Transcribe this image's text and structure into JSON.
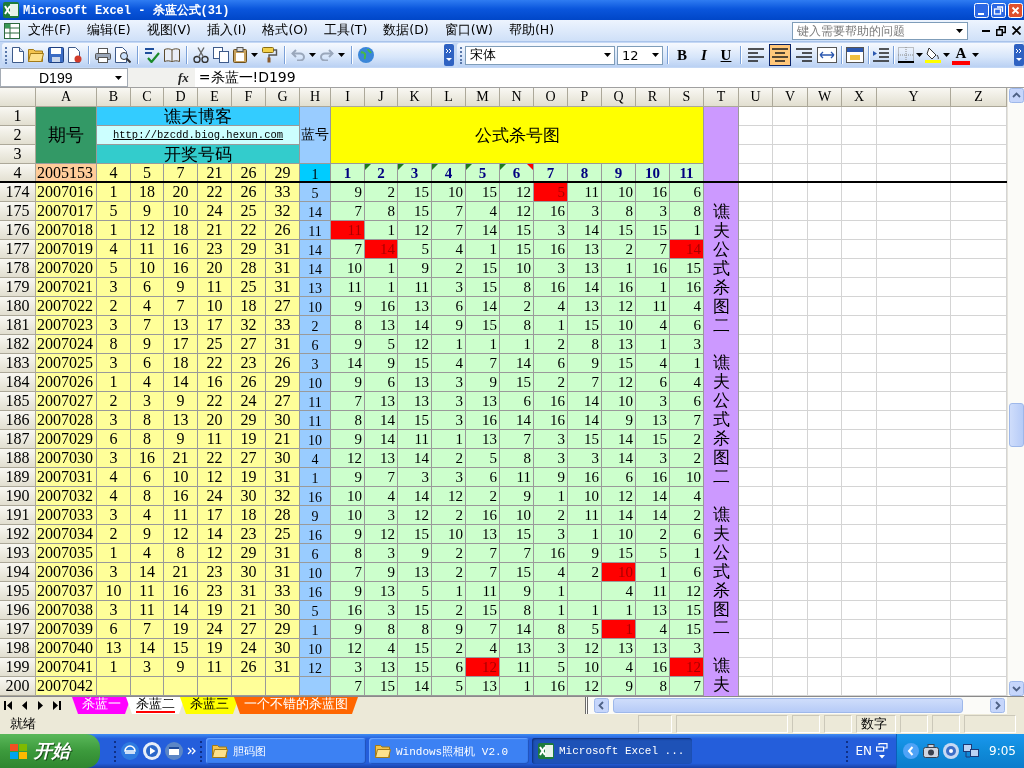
{
  "window": {
    "title": "Microsoft Excel - 杀蓝公式(31)"
  },
  "menu": [
    "文件(F)",
    "编辑(E)",
    "视图(V)",
    "插入(I)",
    "格式(O)",
    "工具(T)",
    "数据(D)",
    "窗口(W)",
    "帮助(H)"
  ],
  "help_box": {
    "placeholder": "键入需要帮助的问题"
  },
  "toolbar": {
    "undo": {
      "disabled": true
    },
    "redo": {
      "disabled": true
    },
    "font": "宋体",
    "font_size": "12",
    "bold": "B",
    "italic": "I",
    "underline": "U",
    "alignment": [
      {
        "kind": "left",
        "selected": false
      },
      {
        "kind": "center",
        "selected": true
      },
      {
        "kind": "right",
        "selected": false
      }
    ],
    "font_color": "A"
  },
  "formula_bar": {
    "name_box": "D199",
    "function_button": "fx",
    "formula": "=杀蓝一!D199"
  },
  "columns": [
    "A",
    "B",
    "C",
    "D",
    "E",
    "F",
    "G",
    "H",
    "I",
    "J",
    "K",
    "L",
    "M",
    "N",
    "O",
    "P",
    "Q",
    "R",
    "S",
    "T",
    "U",
    "V",
    "W",
    "X",
    "Y",
    "Z"
  ],
  "header_block": {
    "row_numbers": [
      "1",
      "2",
      "3"
    ],
    "issue_heading": "期号",
    "blog_title": "谯夫博客",
    "blog_link": "http://bzcdd.biog.hexun.com",
    "draw_heading": "开奖号码",
    "blue_heading": "蓝号",
    "chart_heading": "公式杀号图"
  },
  "row_4": {
    "row_number": "4",
    "issue": "2005153",
    "draw": [
      "4",
      "5",
      "7",
      "21",
      "26",
      "29"
    ],
    "blue": "1",
    "formula_numbers": [
      {
        "label": "1",
        "error_indicator": false,
        "comment_indicator": false
      },
      {
        "label": "2",
        "error_indicator": true,
        "comment_indicator": false
      },
      {
        "label": "3",
        "error_indicator": true,
        "comment_indicator": false
      },
      {
        "label": "4",
        "error_indicator": true,
        "comment_indicator": false
      },
      {
        "label": "5",
        "error_indicator": true,
        "comment_indicator": false
      },
      {
        "label": "6",
        "error_indicator": true,
        "comment_indicator": true
      },
      {
        "label": "7",
        "error_indicator": false,
        "comment_indicator": false
      },
      {
        "label": "8",
        "error_indicator": false,
        "comment_indicator": false
      },
      {
        "label": "9",
        "error_indicator": false,
        "comment_indicator": false
      },
      {
        "label": "10",
        "error_indicator": false,
        "comment_indicator": false
      },
      {
        "label": "11",
        "error_indicator": false,
        "comment_indicator": false
      }
    ]
  },
  "rows": [
    {
      "row_number": "174",
      "issue": "2007016",
      "draw": [
        "1",
        "18",
        "20",
        "22",
        "26",
        "33"
      ],
      "blue": "5",
      "kills": [
        {
          "value": "9",
          "highlighted": false
        },
        {
          "value": "2",
          "highlighted": false
        },
        {
          "value": "15",
          "highlighted": false
        },
        {
          "value": "10",
          "highlighted": false
        },
        {
          "value": "15",
          "highlighted": false
        },
        {
          "value": "12",
          "highlighted": false
        },
        {
          "value": "5",
          "highlighted": true
        },
        {
          "value": "11",
          "highlighted": false
        },
        {
          "value": "10",
          "highlighted": false
        },
        {
          "value": "16",
          "highlighted": false
        },
        {
          "value": "6",
          "highlighted": false
        }
      ]
    },
    {
      "row_number": "175",
      "issue": "2007017",
      "draw": [
        "5",
        "9",
        "10",
        "24",
        "25",
        "32"
      ],
      "blue": "14",
      "kills": [
        {
          "value": "7",
          "highlighted": false
        },
        {
          "value": "8",
          "highlighted": false
        },
        {
          "value": "15",
          "highlighted": false
        },
        {
          "value": "7",
          "highlighted": false
        },
        {
          "value": "4",
          "highlighted": false
        },
        {
          "value": "12",
          "highlighted": false
        },
        {
          "value": "16",
          "highlighted": false
        },
        {
          "value": "3",
          "highlighted": false
        },
        {
          "value": "8",
          "highlighted": false
        },
        {
          "value": "3",
          "highlighted": false
        },
        {
          "value": "8",
          "highlighted": false
        }
      ]
    },
    {
      "row_number": "176",
      "issue": "2007018",
      "draw": [
        "1",
        "12",
        "18",
        "21",
        "22",
        "26"
      ],
      "blue": "11",
      "kills": [
        {
          "value": "11",
          "highlighted": true
        },
        {
          "value": "1",
          "highlighted": false
        },
        {
          "value": "12",
          "highlighted": false
        },
        {
          "value": "7",
          "highlighted": false
        },
        {
          "value": "14",
          "highlighted": false
        },
        {
          "value": "15",
          "highlighted": false
        },
        {
          "value": "3",
          "highlighted": false
        },
        {
          "value": "14",
          "highlighted": false
        },
        {
          "value": "15",
          "highlighted": false
        },
        {
          "value": "15",
          "highlighted": false
        },
        {
          "value": "1",
          "highlighted": false
        }
      ]
    },
    {
      "row_number": "177",
      "issue": "2007019",
      "draw": [
        "4",
        "11",
        "16",
        "23",
        "29",
        "31"
      ],
      "blue": "14",
      "kills": [
        {
          "value": "7",
          "highlighted": false
        },
        {
          "value": "14",
          "highlighted": true
        },
        {
          "value": "5",
          "highlighted": false
        },
        {
          "value": "4",
          "highlighted": false
        },
        {
          "value": "1",
          "highlighted": false
        },
        {
          "value": "15",
          "highlighted": false
        },
        {
          "value": "16",
          "highlighted": false
        },
        {
          "value": "13",
          "highlighted": false
        },
        {
          "value": "2",
          "highlighted": false
        },
        {
          "value": "7",
          "highlighted": false
        },
        {
          "value": "14",
          "highlighted": true
        }
      ]
    },
    {
      "row_number": "178",
      "issue": "2007020",
      "draw": [
        "5",
        "10",
        "16",
        "20",
        "28",
        "31"
      ],
      "blue": "14",
      "kills": [
        {
          "value": "10",
          "highlighted": false
        },
        {
          "value": "1",
          "highlighted": false
        },
        {
          "value": "9",
          "highlighted": false
        },
        {
          "value": "2",
          "highlighted": false
        },
        {
          "value": "15",
          "highlighted": false
        },
        {
          "value": "10",
          "highlighted": false
        },
        {
          "value": "3",
          "highlighted": false
        },
        {
          "value": "13",
          "highlighted": false
        },
        {
          "value": "1",
          "highlighted": false
        },
        {
          "value": "16",
          "highlighted": false
        },
        {
          "value": "15",
          "highlighted": false
        }
      ]
    },
    {
      "row_number": "179",
      "issue": "2007021",
      "draw": [
        "3",
        "6",
        "9",
        "11",
        "25",
        "31"
      ],
      "blue": "13",
      "kills": [
        {
          "value": "11",
          "highlighted": false
        },
        {
          "value": "1",
          "highlighted": false
        },
        {
          "value": "11",
          "highlighted": false
        },
        {
          "value": "3",
          "highlighted": false
        },
        {
          "value": "15",
          "highlighted": false
        },
        {
          "value": "8",
          "highlighted": false
        },
        {
          "value": "16",
          "highlighted": false
        },
        {
          "value": "14",
          "highlighted": false
        },
        {
          "value": "16",
          "highlighted": false
        },
        {
          "value": "1",
          "highlighted": false
        },
        {
          "value": "16",
          "highlighted": false
        }
      ]
    },
    {
      "row_number": "180",
      "issue": "2007022",
      "draw": [
        "2",
        "4",
        "7",
        "10",
        "18",
        "27"
      ],
      "blue": "10",
      "kills": [
        {
          "value": "9",
          "highlighted": false
        },
        {
          "value": "16",
          "highlighted": false
        },
        {
          "value": "13",
          "highlighted": false
        },
        {
          "value": "6",
          "highlighted": false
        },
        {
          "value": "14",
          "highlighted": false
        },
        {
          "value": "2",
          "highlighted": false
        },
        {
          "value": "4",
          "highlighted": false
        },
        {
          "value": "13",
          "highlighted": false
        },
        {
          "value": "12",
          "highlighted": false
        },
        {
          "value": "11",
          "highlighted": false
        },
        {
          "value": "4",
          "highlighted": false
        }
      ]
    },
    {
      "row_number": "181",
      "issue": "2007023",
      "draw": [
        "3",
        "7",
        "13",
        "17",
        "32",
        "33"
      ],
      "blue": "2",
      "kills": [
        {
          "value": "8",
          "highlighted": false
        },
        {
          "value": "13",
          "highlighted": false
        },
        {
          "value": "14",
          "highlighted": false
        },
        {
          "value": "9",
          "highlighted": false
        },
        {
          "value": "15",
          "highlighted": false
        },
        {
          "value": "8",
          "highlighted": false
        },
        {
          "value": "1",
          "highlighted": false
        },
        {
          "value": "15",
          "highlighted": false
        },
        {
          "value": "10",
          "highlighted": false
        },
        {
          "value": "4",
          "highlighted": false
        },
        {
          "value": "6",
          "highlighted": false
        }
      ]
    },
    {
      "row_number": "182",
      "issue": "2007024",
      "draw": [
        "8",
        "9",
        "17",
        "25",
        "27",
        "31"
      ],
      "blue": "6",
      "kills": [
        {
          "value": "9",
          "highlighted": false
        },
        {
          "value": "5",
          "highlighted": false
        },
        {
          "value": "12",
          "highlighted": false
        },
        {
          "value": "1",
          "highlighted": false
        },
        {
          "value": "1",
          "highlighted": false
        },
        {
          "value": "1",
          "highlighted": false
        },
        {
          "value": "2",
          "highlighted": false
        },
        {
          "value": "8",
          "highlighted": false
        },
        {
          "value": "13",
          "highlighted": false
        },
        {
          "value": "1",
          "highlighted": false
        },
        {
          "value": "3",
          "highlighted": false
        }
      ]
    },
    {
      "row_number": "183",
      "issue": "2007025",
      "draw": [
        "3",
        "6",
        "18",
        "22",
        "23",
        "26"
      ],
      "blue": "3",
      "kills": [
        {
          "value": "14",
          "highlighted": false
        },
        {
          "value": "9",
          "highlighted": false
        },
        {
          "value": "15",
          "highlighted": false
        },
        {
          "value": "4",
          "highlighted": false
        },
        {
          "value": "7",
          "highlighted": false
        },
        {
          "value": "14",
          "highlighted": false
        },
        {
          "value": "6",
          "highlighted": false
        },
        {
          "value": "9",
          "highlighted": false
        },
        {
          "value": "15",
          "highlighted": false
        },
        {
          "value": "4",
          "highlighted": false
        },
        {
          "value": "1",
          "highlighted": false
        }
      ]
    },
    {
      "row_number": "184",
      "issue": "2007026",
      "draw": [
        "1",
        "4",
        "14",
        "16",
        "26",
        "29"
      ],
      "blue": "10",
      "kills": [
        {
          "value": "9",
          "highlighted": false
        },
        {
          "value": "6",
          "highlighted": false
        },
        {
          "value": "13",
          "highlighted": false
        },
        {
          "value": "3",
          "highlighted": false
        },
        {
          "value": "9",
          "highlighted": false
        },
        {
          "value": "15",
          "highlighted": false
        },
        {
          "value": "2",
          "highlighted": false
        },
        {
          "value": "7",
          "highlighted": false
        },
        {
          "value": "12",
          "highlighted": false
        },
        {
          "value": "6",
          "highlighted": false
        },
        {
          "value": "4",
          "highlighted": false
        }
      ]
    },
    {
      "row_number": "185",
      "issue": "2007027",
      "draw": [
        "2",
        "3",
        "9",
        "22",
        "24",
        "27"
      ],
      "blue": "11",
      "kills": [
        {
          "value": "7",
          "highlighted": false
        },
        {
          "value": "13",
          "highlighted": false
        },
        {
          "value": "13",
          "highlighted": false
        },
        {
          "value": "3",
          "highlighted": false
        },
        {
          "value": "13",
          "highlighted": false
        },
        {
          "value": "6",
          "highlighted": false
        },
        {
          "value": "16",
          "highlighted": false
        },
        {
          "value": "14",
          "highlighted": false
        },
        {
          "value": "10",
          "highlighted": false
        },
        {
          "value": "3",
          "highlighted": false
        },
        {
          "value": "6",
          "highlighted": false
        }
      ]
    },
    {
      "row_number": "186",
      "issue": "2007028",
      "draw": [
        "3",
        "8",
        "13",
        "20",
        "29",
        "30"
      ],
      "blue": "11",
      "kills": [
        {
          "value": "8",
          "highlighted": false
        },
        {
          "value": "14",
          "highlighted": false
        },
        {
          "value": "15",
          "highlighted": false
        },
        {
          "value": "3",
          "highlighted": false
        },
        {
          "value": "16",
          "highlighted": false
        },
        {
          "value": "14",
          "highlighted": false
        },
        {
          "value": "16",
          "highlighted": false
        },
        {
          "value": "14",
          "highlighted": false
        },
        {
          "value": "9",
          "highlighted": false
        },
        {
          "value": "13",
          "highlighted": false
        },
        {
          "value": "7",
          "highlighted": false
        }
      ]
    },
    {
      "row_number": "187",
      "issue": "2007029",
      "draw": [
        "6",
        "8",
        "9",
        "11",
        "19",
        "21"
      ],
      "blue": "10",
      "kills": [
        {
          "value": "9",
          "highlighted": false
        },
        {
          "value": "14",
          "highlighted": false
        },
        {
          "value": "11",
          "highlighted": false
        },
        {
          "value": "1",
          "highlighted": false
        },
        {
          "value": "13",
          "highlighted": false
        },
        {
          "value": "7",
          "highlighted": false
        },
        {
          "value": "3",
          "highlighted": false
        },
        {
          "value": "15",
          "highlighted": false
        },
        {
          "value": "14",
          "highlighted": false
        },
        {
          "value": "15",
          "highlighted": false
        },
        {
          "value": "2",
          "highlighted": false
        }
      ]
    },
    {
      "row_number": "188",
      "issue": "2007030",
      "draw": [
        "3",
        "16",
        "21",
        "22",
        "27",
        "30"
      ],
      "blue": "4",
      "kills": [
        {
          "value": "12",
          "highlighted": false
        },
        {
          "value": "13",
          "highlighted": false
        },
        {
          "value": "14",
          "highlighted": false
        },
        {
          "value": "2",
          "highlighted": false
        },
        {
          "value": "5",
          "highlighted": false
        },
        {
          "value": "8",
          "highlighted": false
        },
        {
          "value": "3",
          "highlighted": false
        },
        {
          "value": "3",
          "highlighted": false
        },
        {
          "value": "14",
          "highlighted": false
        },
        {
          "value": "3",
          "highlighted": false
        },
        {
          "value": "2",
          "highlighted": false
        }
      ]
    },
    {
      "row_number": "189",
      "issue": "2007031",
      "draw": [
        "4",
        "6",
        "10",
        "12",
        "19",
        "31"
      ],
      "blue": "1",
      "kills": [
        {
          "value": "9",
          "highlighted": false
        },
        {
          "value": "7",
          "highlighted": false
        },
        {
          "value": "3",
          "highlighted": false
        },
        {
          "value": "3",
          "highlighted": false
        },
        {
          "value": "6",
          "highlighted": false
        },
        {
          "value": "11",
          "highlighted": false
        },
        {
          "value": "9",
          "highlighted": false
        },
        {
          "value": "16",
          "highlighted": false
        },
        {
          "value": "6",
          "highlighted": false
        },
        {
          "value": "16",
          "highlighted": false
        },
        {
          "value": "10",
          "highlighted": false
        }
      ]
    },
    {
      "row_number": "190",
      "issue": "2007032",
      "draw": [
        "4",
        "8",
        "16",
        "24",
        "30",
        "32"
      ],
      "blue": "16",
      "kills": [
        {
          "value": "10",
          "highlighted": false
        },
        {
          "value": "4",
          "highlighted": false
        },
        {
          "value": "14",
          "highlighted": false
        },
        {
          "value": "12",
          "highlighted": false
        },
        {
          "value": "2",
          "highlighted": false
        },
        {
          "value": "9",
          "highlighted": false
        },
        {
          "value": "1",
          "highlighted": false
        },
        {
          "value": "10",
          "highlighted": false
        },
        {
          "value": "12",
          "highlighted": false
        },
        {
          "value": "14",
          "highlighted": false
        },
        {
          "value": "4",
          "highlighted": false
        }
      ]
    },
    {
      "row_number": "191",
      "issue": "2007033",
      "draw": [
        "3",
        "4",
        "11",
        "17",
        "18",
        "28"
      ],
      "blue": "9",
      "kills": [
        {
          "value": "10",
          "highlighted": false
        },
        {
          "value": "3",
          "highlighted": false
        },
        {
          "value": "12",
          "highlighted": false
        },
        {
          "value": "2",
          "highlighted": false
        },
        {
          "value": "16",
          "highlighted": false
        },
        {
          "value": "10",
          "highlighted": false
        },
        {
          "value": "2",
          "highlighted": false
        },
        {
          "value": "11",
          "highlighted": false
        },
        {
          "value": "14",
          "highlighted": false
        },
        {
          "value": "14",
          "highlighted": false
        },
        {
          "value": "2",
          "highlighted": false
        }
      ]
    },
    {
      "row_number": "192",
      "issue": "2007034",
      "draw": [
        "2",
        "9",
        "12",
        "14",
        "23",
        "25"
      ],
      "blue": "16",
      "kills": [
        {
          "value": "9",
          "highlighted": false
        },
        {
          "value": "12",
          "highlighted": false
        },
        {
          "value": "15",
          "highlighted": false
        },
        {
          "value": "10",
          "highlighted": false
        },
        {
          "value": "13",
          "highlighted": false
        },
        {
          "value": "15",
          "highlighted": false
        },
        {
          "value": "3",
          "highlighted": false
        },
        {
          "value": "1",
          "highlighted": false
        },
        {
          "value": "10",
          "highlighted": false
        },
        {
          "value": "2",
          "highlighted": false
        },
        {
          "value": "6",
          "highlighted": false
        }
      ]
    },
    {
      "row_number": "193",
      "issue": "2007035",
      "draw": [
        "1",
        "4",
        "8",
        "12",
        "29",
        "31"
      ],
      "blue": "6",
      "kills": [
        {
          "value": "8",
          "highlighted": false
        },
        {
          "value": "3",
          "highlighted": false
        },
        {
          "value": "9",
          "highlighted": false
        },
        {
          "value": "2",
          "highlighted": false
        },
        {
          "value": "7",
          "highlighted": false
        },
        {
          "value": "7",
          "highlighted": false
        },
        {
          "value": "16",
          "highlighted": false
        },
        {
          "value": "9",
          "highlighted": false
        },
        {
          "value": "15",
          "highlighted": false
        },
        {
          "value": "5",
          "highlighted": false
        },
        {
          "value": "1",
          "highlighted": false
        }
      ]
    },
    {
      "row_number": "194",
      "issue": "2007036",
      "draw": [
        "3",
        "14",
        "21",
        "23",
        "30",
        "31"
      ],
      "blue": "10",
      "kills": [
        {
          "value": "7",
          "highlighted": false
        },
        {
          "value": "9",
          "highlighted": false
        },
        {
          "value": "13",
          "highlighted": false
        },
        {
          "value": "2",
          "highlighted": false
        },
        {
          "value": "7",
          "highlighted": false
        },
        {
          "value": "15",
          "highlighted": false
        },
        {
          "value": "4",
          "highlighted": false
        },
        {
          "value": "2",
          "highlighted": false
        },
        {
          "value": "10",
          "highlighted": true
        },
        {
          "value": "1",
          "highlighted": false
        },
        {
          "value": "6",
          "highlighted": false
        }
      ]
    },
    {
      "row_number": "195",
      "issue": "2007037",
      "draw": [
        "10",
        "11",
        "16",
        "23",
        "31",
        "33"
      ],
      "blue": "16",
      "kills": [
        {
          "value": "9",
          "highlighted": false
        },
        {
          "value": "13",
          "highlighted": false
        },
        {
          "value": "5",
          "highlighted": false
        },
        {
          "value": "1",
          "highlighted": false
        },
        {
          "value": "11",
          "highlighted": false
        },
        {
          "value": "9",
          "highlighted": false
        },
        {
          "value": "1",
          "highlighted": false
        },
        {
          "highlighted": false
        },
        {
          "value": "4",
          "highlighted": false
        },
        {
          "value": "11",
          "highlighted": false
        },
        {
          "value": "12",
          "highlighted": false
        }
      ]
    },
    {
      "row_number": "196",
      "issue": "2007038",
      "draw": [
        "3",
        "11",
        "14",
        "19",
        "21",
        "30"
      ],
      "blue": "5",
      "kills": [
        {
          "value": "16",
          "highlighted": false
        },
        {
          "value": "3",
          "highlighted": false
        },
        {
          "value": "15",
          "highlighted": false
        },
        {
          "value": "2",
          "highlighted": false
        },
        {
          "value": "15",
          "highlighted": false
        },
        {
          "value": "8",
          "highlighted": false
        },
        {
          "value": "1",
          "highlighted": false
        },
        {
          "value": "1",
          "highlighted": false
        },
        {
          "value": "1",
          "highlighted": false
        },
        {
          "value": "13",
          "highlighted": false
        },
        {
          "value": "15",
          "highlighted": false
        }
      ]
    },
    {
      "row_number": "197",
      "issue": "2007039",
      "draw": [
        "6",
        "7",
        "19",
        "24",
        "27",
        "29"
      ],
      "blue": "1",
      "kills": [
        {
          "value": "9",
          "highlighted": false
        },
        {
          "value": "8",
          "highlighted": false
        },
        {
          "value": "8",
          "highlighted": false
        },
        {
          "value": "9",
          "highlighted": false
        },
        {
          "value": "7",
          "highlighted": false
        },
        {
          "value": "14",
          "highlighted": false
        },
        {
          "value": "8",
          "highlighted": false
        },
        {
          "value": "5",
          "highlighted": false
        },
        {
          "value": "1",
          "highlighted": true
        },
        {
          "value": "4",
          "highlighted": false
        },
        {
          "value": "15",
          "highlighted": false
        }
      ]
    },
    {
      "row_number": "198",
      "issue": "2007040",
      "draw": [
        "13",
        "14",
        "15",
        "19",
        "24",
        "30"
      ],
      "blue": "10",
      "kills": [
        {
          "value": "12",
          "highlighted": false
        },
        {
          "value": "4",
          "highlighted": false
        },
        {
          "value": "15",
          "highlighted": false
        },
        {
          "value": "2",
          "highlighted": false
        },
        {
          "value": "4",
          "highlighted": false
        },
        {
          "value": "13",
          "highlighted": false
        },
        {
          "value": "3",
          "highlighted": false
        },
        {
          "value": "12",
          "highlighted": false
        },
        {
          "value": "13",
          "highlighted": false
        },
        {
          "value": "13",
          "highlighted": false
        },
        {
          "value": "3",
          "highlighted": false
        }
      ]
    },
    {
      "row_number": "199",
      "issue": "2007041",
      "draw": [
        "1",
        "3",
        "9",
        "11",
        "26",
        "31"
      ],
      "blue": "12",
      "kills": [
        {
          "value": "3",
          "highlighted": false
        },
        {
          "value": "13",
          "highlighted": false
        },
        {
          "value": "15",
          "highlighted": false
        },
        {
          "value": "6",
          "highlighted": false
        },
        {
          "value": "12",
          "highlighted": true
        },
        {
          "value": "11",
          "highlighted": false
        },
        {
          "value": "5",
          "highlighted": false
        },
        {
          "value": "10",
          "highlighted": false
        },
        {
          "value": "4",
          "highlighted": false
        },
        {
          "value": "16",
          "highlighted": false
        },
        {
          "value": "12",
          "highlighted": true
        }
      ]
    },
    {
      "row_number": "200",
      "issue": "2007042",
      "kills": [
        {
          "value": "7",
          "highlighted": false
        },
        {
          "value": "15",
          "highlighted": false
        },
        {
          "value": "14",
          "highlighted": false
        },
        {
          "value": "5",
          "highlighted": false
        },
        {
          "value": "13",
          "highlighted": false
        },
        {
          "value": "1",
          "highlighted": false
        },
        {
          "value": "16",
          "highlighted": false
        },
        {
          "value": "12",
          "highlighted": false
        },
        {
          "value": "9",
          "highlighted": false
        },
        {
          "value": "8",
          "highlighted": false
        },
        {
          "value": "7",
          "highlighted": false
        }
      ]
    }
  ],
  "vertical_labels": [
    "谯夫公式杀图二",
    "谯夫公式杀图二",
    "谯夫公式杀图二",
    "谯夫"
  ],
  "sheet_tabs": [
    {
      "label": "杀蓝一",
      "selected": false,
      "color": "#ff00ff"
    },
    {
      "label": "杀蓝二",
      "selected": true,
      "color": "#ff0000"
    },
    {
      "label": "杀蓝三",
      "selected": false,
      "color": "#ffff00"
    },
    {
      "label": "一个不错的杀蓝图",
      "selected": false,
      "color": "#ff6600"
    }
  ],
  "status_bar": {
    "status": "就绪",
    "mode": "数字"
  },
  "taskbar": {
    "start": "开始",
    "tasks": [
      {
        "kind": "folder",
        "label": "胆码图",
        "selected": false
      },
      {
        "kind": "folder",
        "label": "Windows照相机 V2.0",
        "selected": false
      },
      {
        "kind": "excel",
        "label": "Microsoft Excel ...",
        "selected": true
      }
    ],
    "language": "EN",
    "clock": "9:05"
  }
}
